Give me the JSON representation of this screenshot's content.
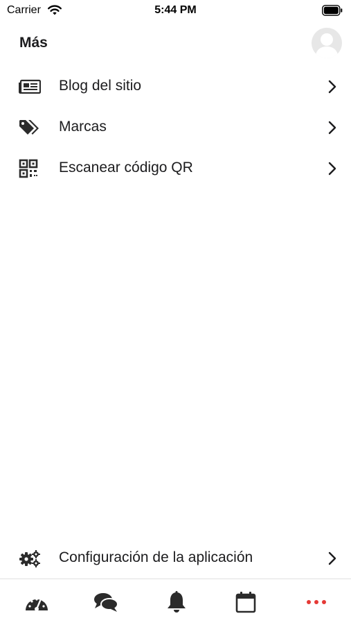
{
  "status_bar": {
    "carrier": "Carrier",
    "time": "5:44 PM"
  },
  "header": {
    "title": "Más"
  },
  "menu": {
    "items": [
      {
        "label": "Blog del sitio",
        "icon": "newspaper-icon"
      },
      {
        "label": "Marcas",
        "icon": "tags-icon"
      },
      {
        "label": "Escanear código QR",
        "icon": "qr-code-icon"
      }
    ]
  },
  "settings": {
    "label": "Configuración de la aplicación",
    "icon": "gears-icon"
  },
  "tabbar": {
    "tabs": [
      {
        "icon": "dashboard-icon"
      },
      {
        "icon": "chat-icon"
      },
      {
        "icon": "bell-icon"
      },
      {
        "icon": "calendar-icon"
      },
      {
        "icon": "more-dots-icon",
        "active": true
      }
    ],
    "active_color": "#e53935",
    "icon_color": "#2b2b2b"
  }
}
